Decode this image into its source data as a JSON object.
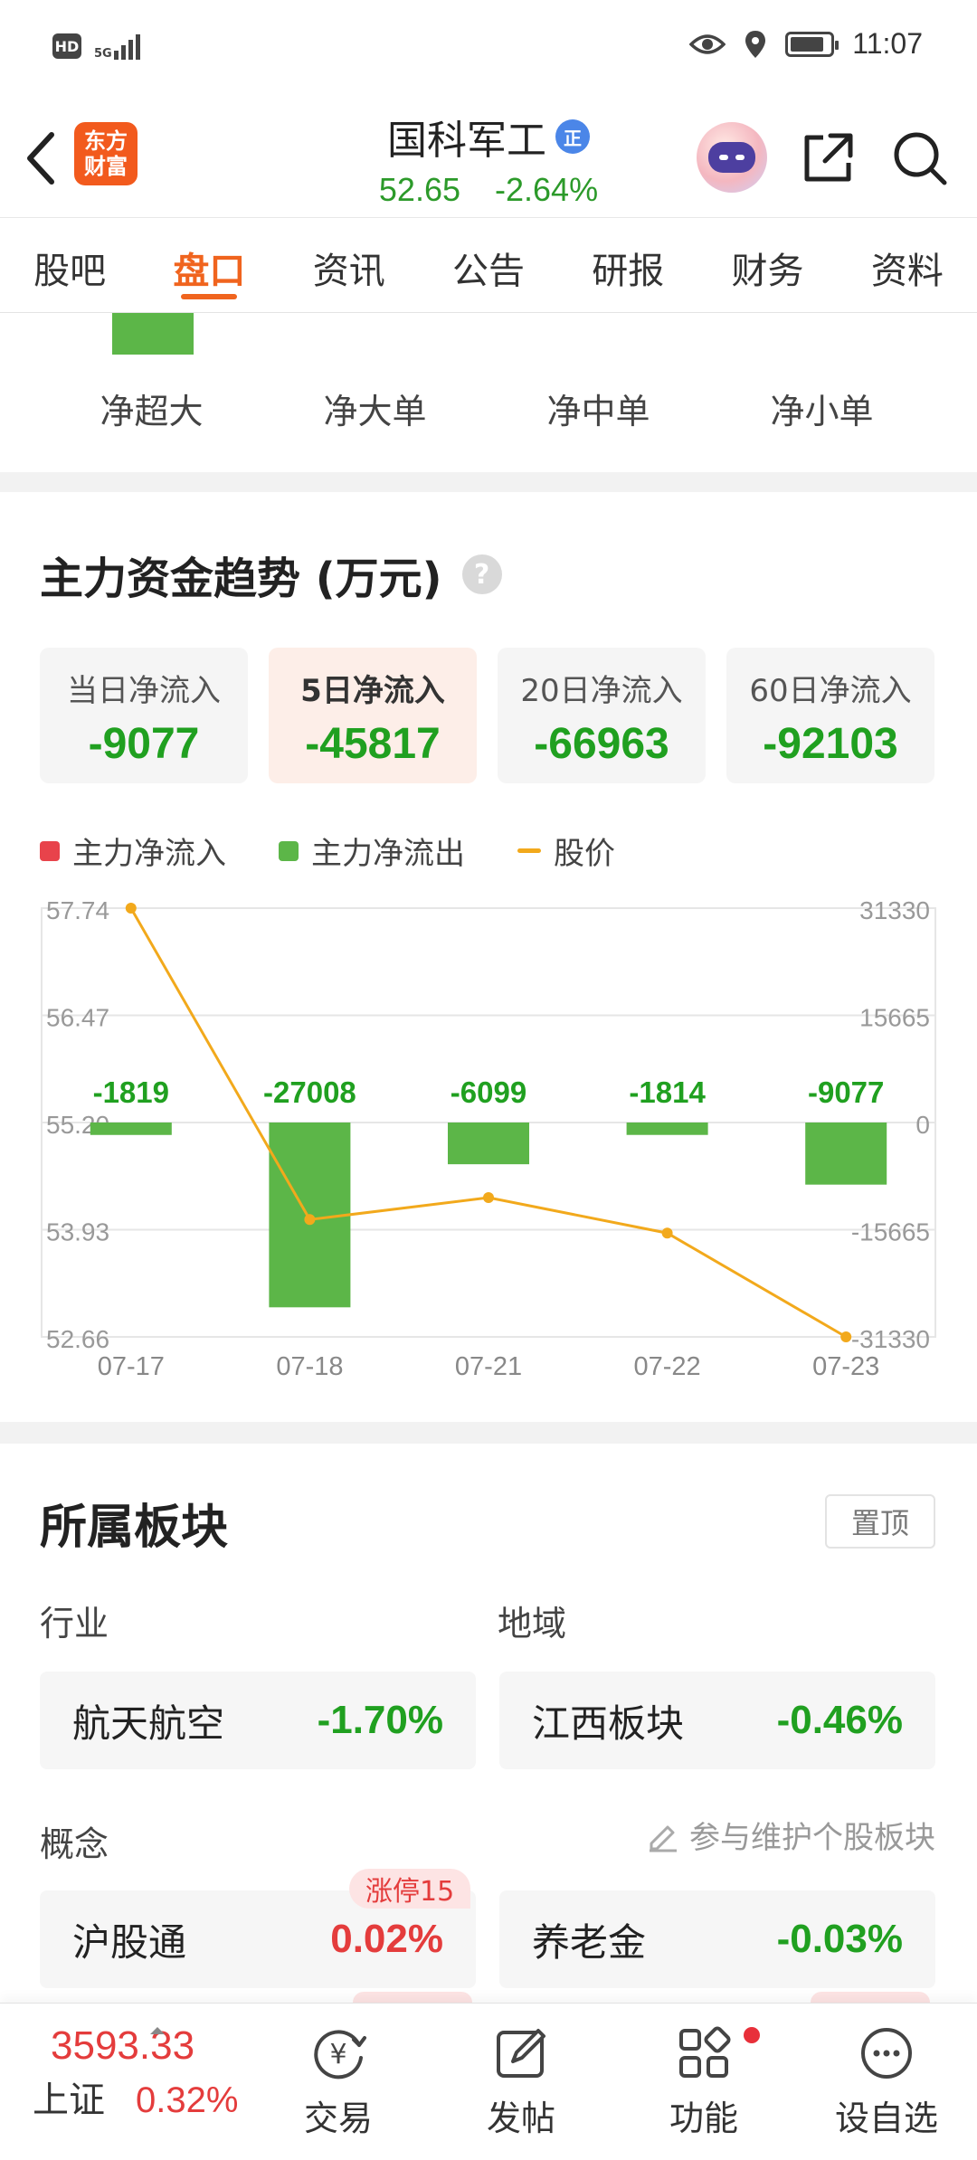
{
  "status_bar": {
    "hd": "HD",
    "network": "5G",
    "time": "11:07",
    "battery_level": 0.85
  },
  "header": {
    "logo_line1": "东方",
    "logo_line2": "财富",
    "stock_name": "国科军工",
    "badge": "正",
    "price": "52.65",
    "change_pct": "-2.64%"
  },
  "tabs": [
    {
      "label": "股吧"
    },
    {
      "label": "盘口",
      "active": true
    },
    {
      "label": "资讯"
    },
    {
      "label": "公告"
    },
    {
      "label": "研报"
    },
    {
      "label": "财务"
    },
    {
      "label": "资料"
    }
  ],
  "flow_labels": [
    "净超大",
    "净大单",
    "净中单",
    "净小单"
  ],
  "trend": {
    "title": "主力资金趋势 (万元)",
    "help": "?",
    "periods": [
      {
        "label": "当日净流入",
        "value": "-9077"
      },
      {
        "label": "5日净流入",
        "value": "-45817",
        "active": true
      },
      {
        "label": "20日净流入",
        "value": "-66963"
      },
      {
        "label": "60日净流入",
        "value": "-92103"
      }
    ],
    "legend": [
      {
        "label": "主力净流入",
        "color": "#e8434b",
        "kind": "square"
      },
      {
        "label": "主力净流出",
        "color": "#5cb648",
        "kind": "square"
      },
      {
        "label": "股价",
        "color": "#f2a91c",
        "kind": "line"
      }
    ]
  },
  "chart_data": {
    "type": "bar",
    "categories": [
      "07-17",
      "07-18",
      "07-21",
      "07-22",
      "07-23"
    ],
    "series": [
      {
        "name": "主力净流出",
        "values": [
          -1819,
          -27008,
          -6099,
          -1814,
          -9077
        ],
        "axis": "right",
        "color": "#5cb648"
      },
      {
        "name": "股价",
        "values": [
          57.74,
          54.05,
          54.31,
          53.89,
          52.66
        ],
        "axis": "left",
        "type": "line",
        "color": "#f2a91c"
      }
    ],
    "left_ticks": [
      "57.74",
      "56.47",
      "55.20",
      "53.93",
      "52.66"
    ],
    "right_ticks": [
      "31330",
      "15665",
      "0",
      "-15665",
      "-31330"
    ],
    "ylim_left": [
      52.66,
      57.74
    ],
    "ylim_right": [
      -31330,
      31330
    ],
    "grid": true
  },
  "sectors": {
    "title": "所属板块",
    "pin_label": "置顶",
    "industry_label": "行业",
    "region_label": "地域",
    "industry": {
      "name": "航天航空",
      "pct": "-1.70%"
    },
    "region": {
      "name": "江西板块",
      "pct": "-0.46%"
    },
    "concept_label": "概念",
    "maintain_label": "参与维护个股板块",
    "concepts": [
      {
        "name": "沪股通",
        "pct": "0.02%",
        "tag": "涨停15"
      },
      {
        "name": "养老金",
        "pct": "-0.03%"
      }
    ]
  },
  "bottom_nav": {
    "index_value": "3593.33",
    "index_name": "上证",
    "index_change": "0.32%",
    "items": [
      {
        "label": "交易"
      },
      {
        "label": "发帖"
      },
      {
        "label": "功能"
      },
      {
        "label": "设自选"
      }
    ]
  }
}
